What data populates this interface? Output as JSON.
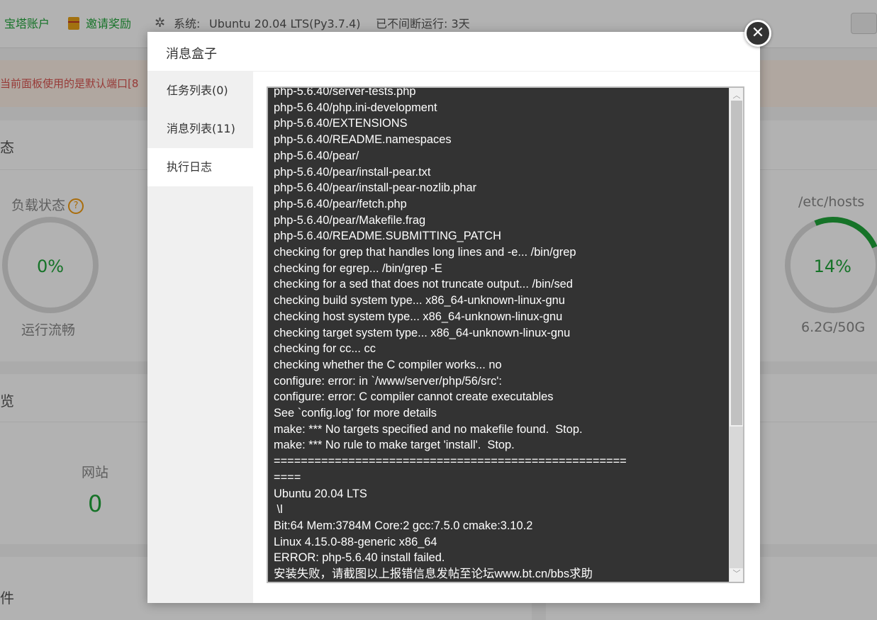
{
  "topbar": {
    "account_label": "宝塔账户",
    "invite_label": "邀请奖励",
    "system_label": "系统:",
    "system_value": "Ubuntu 20.04 LTS(Py3.7.4)",
    "uptime": "已不间断运行: 3天"
  },
  "warning_text": "当前面板使用的是默认端口[8",
  "status_panel": {
    "title": "态",
    "load": {
      "title": "负载状态",
      "percent": "0%",
      "status": "运行流畅"
    },
    "disk": {
      "title": "/etc/hosts",
      "percent": "14%",
      "usage": "6.2G/50G"
    }
  },
  "overview_panel": {
    "title": "览",
    "site_label": "网站",
    "site_count": "0"
  },
  "software_panel": {
    "title": "件"
  },
  "modal": {
    "title": "消息盒子",
    "close_glyph": "✕",
    "tabs": [
      {
        "label": "任务列表(0)"
      },
      {
        "label": "消息列表(11)"
      },
      {
        "label": "执行日志",
        "active": true
      }
    ],
    "log_lines": [
      "php-5.6.40/server-tests.php",
      "php-5.6.40/php.ini-development",
      "php-5.6.40/EXTENSIONS",
      "php-5.6.40/README.namespaces",
      "php-5.6.40/pear/",
      "php-5.6.40/pear/install-pear.txt",
      "php-5.6.40/pear/install-pear-nozlib.phar",
      "php-5.6.40/pear/fetch.php",
      "php-5.6.40/pear/Makefile.frag",
      "php-5.6.40/README.SUBMITTING_PATCH",
      "checking for grep that handles long lines and -e... /bin/grep",
      "checking for egrep... /bin/grep -E",
      "checking for a sed that does not truncate output... /bin/sed",
      "checking build system type... x86_64-unknown-linux-gnu",
      "checking host system type... x86_64-unknown-linux-gnu",
      "checking target system type... x86_64-unknown-linux-gnu",
      "checking for cc... cc",
      "checking whether the C compiler works... no",
      "configure: error: in `/www/server/php/56/src':",
      "configure: error: C compiler cannot create executables",
      "See `config.log' for more details",
      "make: *** No targets specified and no makefile found.  Stop.",
      "make: *** No rule to make target 'install'.  Stop.",
      "====================================================",
      "====",
      "Ubuntu 20.04 LTS",
      " \\l",
      "Bit:64 Mem:3784M Core:2 gcc:7.5.0 cmake:3.10.2",
      "Linux 4.15.0-88-generic x86_64",
      "ERROR: php-5.6.40 install failed.",
      "安装失败，请截图以上报错信息发帖至论坛www.bt.cn/bbs求助"
    ]
  },
  "colors": {
    "accent_green": "#20a53a",
    "warning_red": "#d9534f",
    "log_bg": "#333333"
  }
}
